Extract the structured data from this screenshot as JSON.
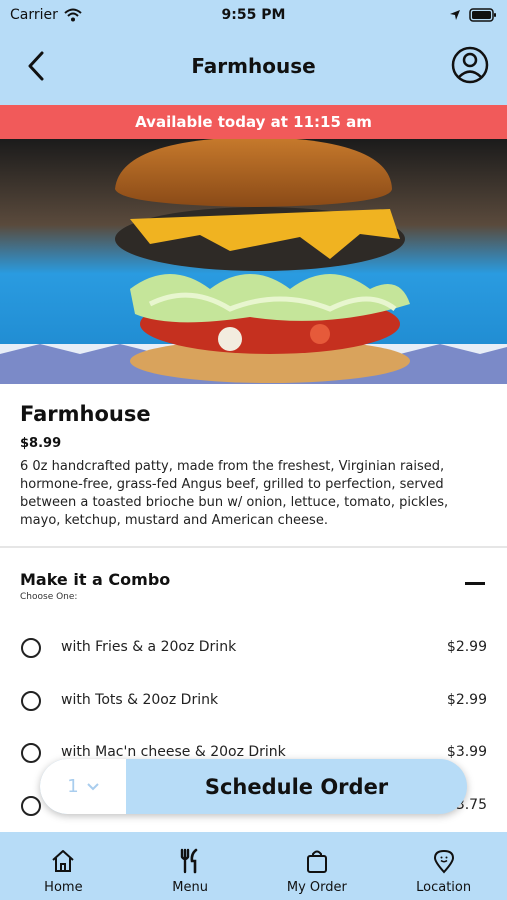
{
  "status_bar": {
    "carrier": "Carrier",
    "time": "9:55 PM"
  },
  "header": {
    "title": "Farmhouse"
  },
  "banner": {
    "text": "Available today at 11:15 am"
  },
  "item": {
    "name": "Farmhouse",
    "price": "$8.99",
    "description": "6 0z handcrafted patty, made from the freshest, Virginian raised, hormone-free, grass-fed Angus beef, grilled to perfection, served between a toasted brioche bun w/ onion, lettuce, tomato, pickles, mayo, ketchup, mustard and American cheese."
  },
  "combo": {
    "title": "Make it a Combo",
    "subtitle": "Choose One:",
    "options": [
      {
        "label": "with Fries & a 20oz Drink",
        "price": "$2.99"
      },
      {
        "label": "with Tots & 20oz Drink",
        "price": "$2.99"
      },
      {
        "label": "with Mac'n cheese & 20oz Drink",
        "price": "$3.99"
      },
      {
        "label": "",
        "price": "$3.75"
      }
    ]
  },
  "order_bar": {
    "quantity": "1",
    "button_label": "Schedule Order"
  },
  "nav": {
    "items": [
      {
        "label": "Home",
        "icon": "home-icon"
      },
      {
        "label": "Menu",
        "icon": "fork-knife-icon"
      },
      {
        "label": "My Order",
        "icon": "shopping-bag-icon"
      },
      {
        "label": "Location",
        "icon": "location-pin-icon"
      }
    ]
  },
  "colors": {
    "header_bg": "#b7dcf7",
    "banner_bg": "#f15a5a"
  }
}
